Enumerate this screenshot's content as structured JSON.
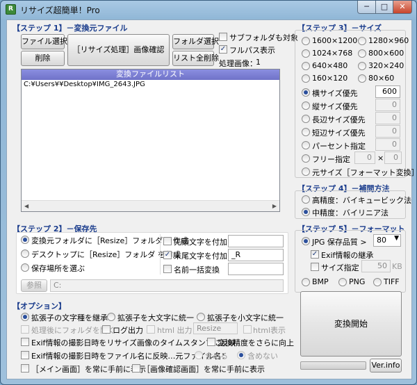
{
  "window": {
    "title": "リサイズ超簡単！Pro",
    "app_icon": "R",
    "min_icon": "─",
    "max_icon": "□",
    "close_icon": "✕"
  },
  "step1": {
    "heading": "【ステップ 1】－変換元ファイル",
    "file_select": "ファイル選択",
    "delete": "削除",
    "resize_confirm": "［リサイズ処理］画像確認",
    "folder_select": "フォルダ選択",
    "list_clear": "リスト全削除",
    "subfolder_label": "サブフォルダも対象",
    "fullpath_label": "フルパス表示",
    "processed_label": "処理画像：",
    "processed_count": "1",
    "list_header": "変換ファイルリスト",
    "files": [
      "C:¥Users¥¥Desktop¥IMG_2643.JPG"
    ]
  },
  "step2": {
    "heading": "【ステップ 2】－保存先",
    "opt_source": "変換元フォルダに［Resize］フォルダ を作成",
    "opt_desktop": "デスクトップに［Resize］フォルダ を作成",
    "opt_choose": "保存場所を選ぶ",
    "prefix_label": "先頭文字を付加",
    "prefix_value": "",
    "suffix_label": "末尾文字を付加",
    "suffix_value": "_R",
    "rename_label": "名前一括変換",
    "rename_value": "",
    "browse": "参照",
    "path_value": "C:"
  },
  "options": {
    "heading": "【オプション】",
    "ext_keep": "拡張子の文字種を継承",
    "ext_upper": "拡張子を大文字に統一",
    "ext_lower": "拡張子を小文字に統一",
    "open_folder": "処理後にフォルダを開く",
    "log_output": "ログ出力",
    "html_output": "html 出力",
    "html_folder": "Resize",
    "html_display": "html表示",
    "exif_timestamp": "Exif情報の撮影日時をリサイズ画像のタイムスタンプに反映",
    "precision_up": "変換精度をさらに向上",
    "exif_filename": "Exif情報の撮影日時をファイル名に反映…元ファイル名：",
    "include": "含める",
    "exclude": "含めない",
    "main_top": "［メイン画面］を常に手前に表示",
    "preview_top": "［画像確認画面］を常に手前に表示"
  },
  "step3": {
    "heading": "【ステップ 3】－サイズ",
    "presets": [
      "1600×1200",
      "1280×960",
      "1024×768",
      "800×600",
      "640×480",
      "320×240",
      "160×120",
      "80×60"
    ],
    "width_priority": "横サイズ優先",
    "width_value": "600",
    "height_priority": "縦サイズ優先",
    "height_value": "0",
    "long_side": "長辺サイズ優先",
    "long_value": "0",
    "short_side": "短辺サイズ優先",
    "short_value": "0",
    "percent": "パーセント指定",
    "percent_value": "0",
    "free": "フリー指定",
    "free_w": "0",
    "free_x": "×",
    "free_h": "0",
    "original": "元サイズ［フォーマット変換］"
  },
  "step4": {
    "heading": "【ステップ 4】－補間方法",
    "high": "高精度：バイキュービック法",
    "mid": "中精度：バイリニア法"
  },
  "step5": {
    "heading": "【ステップ 5】－フォーマット",
    "jpg_label": "JPG  保存品質 >",
    "quality": "80",
    "exif_keep": "Exif情報の継承",
    "size_spec": "サイズ指定",
    "size_value": "50",
    "size_unit": "KB",
    "bmp": "BMP",
    "png": "PNG",
    "tiff": "TIFF"
  },
  "actions": {
    "start": "変換開始",
    "ver": "Ver.info"
  },
  "progress": 0,
  "colors": {
    "heading": "#1a3c8c",
    "list_header": "#7377cc",
    "radio_dot": "#2b4f9c"
  }
}
